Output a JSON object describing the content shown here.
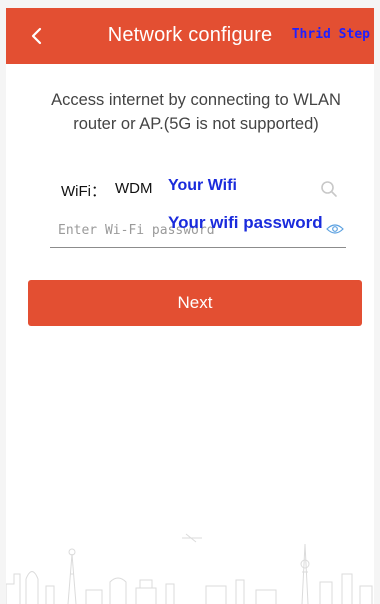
{
  "header": {
    "title": "Network configure",
    "step_note": "Thrid Step",
    "back_icon": "chevron-left-icon",
    "color": "#e34f32"
  },
  "description": "Access internet by connecting to WLAN router or AP.(5G is not supported)",
  "wifi": {
    "label": "WiFi：",
    "name": "WDM",
    "annotation": "Your Wifi",
    "search_icon": "search-icon"
  },
  "password": {
    "placeholder": "Enter Wi-Fi password",
    "annotation": "Your wifi password",
    "eye_icon": "eye-icon"
  },
  "next_button": {
    "label": "Next",
    "color": "#e34f32"
  },
  "annotation_color": "#1a2bdc"
}
